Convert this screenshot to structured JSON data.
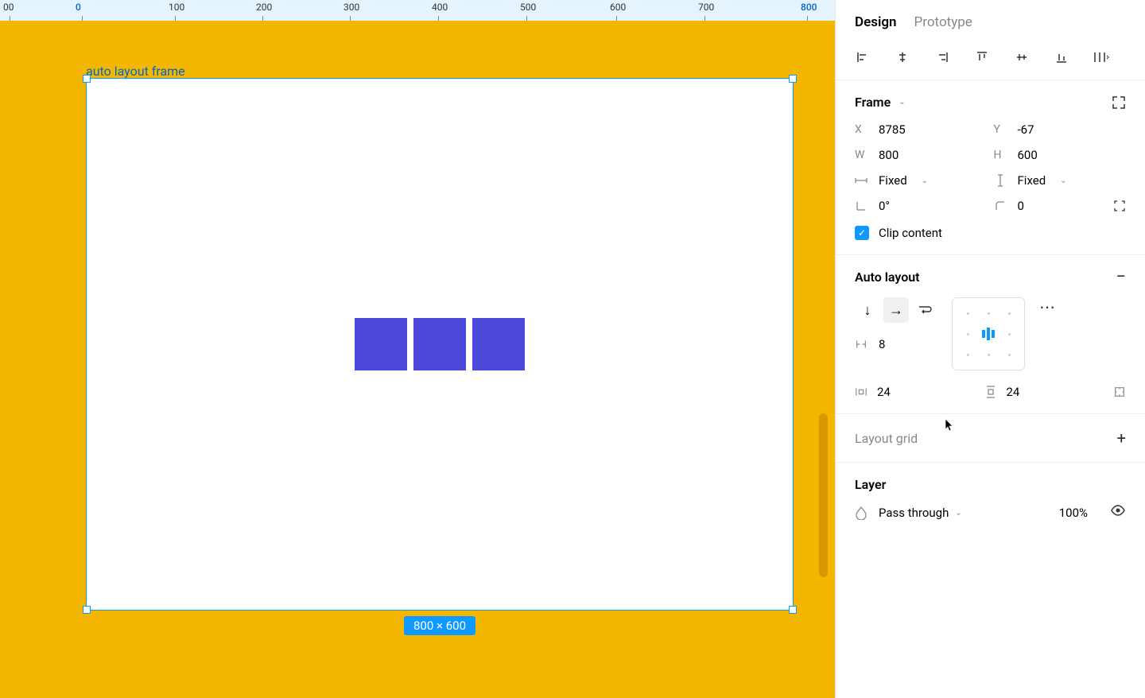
{
  "tabs": {
    "design": "Design",
    "prototype": "Prototype"
  },
  "ruler": {
    "marks": [
      {
        "label": "00",
        "pos": 4,
        "highlight": false
      },
      {
        "label": "0",
        "pos": 95,
        "highlight": true
      },
      {
        "label": "100",
        "pos": 212,
        "highlight": false
      },
      {
        "label": "200",
        "pos": 322,
        "highlight": false
      },
      {
        "label": "300",
        "pos": 432,
        "highlight": false
      },
      {
        "label": "400",
        "pos": 543,
        "highlight": false
      },
      {
        "label": "500",
        "pos": 654,
        "highlight": false
      },
      {
        "label": "600",
        "pos": 767,
        "highlight": false
      },
      {
        "label": "700",
        "pos": 878,
        "highlight": false
      },
      {
        "label": "800",
        "pos": 1007,
        "highlight": true
      }
    ]
  },
  "canvas": {
    "frame_label": "auto layout frame",
    "dimensions_badge": "800 × 600",
    "shape_color": "#4d49d8"
  },
  "frame": {
    "title": "Frame",
    "x_label": "X",
    "x_value": "8785",
    "y_label": "Y",
    "y_value": "-67",
    "w_label": "W",
    "w_value": "800",
    "h_label": "H",
    "h_value": "600",
    "wmode": "Fixed",
    "hmode": "Fixed",
    "rotation": "0°",
    "radius": "0",
    "clip_label": "Clip content"
  },
  "autolayout": {
    "title": "Auto layout",
    "gap": "8",
    "pad_h": "24",
    "pad_v": "24"
  },
  "layout_grid": {
    "title": "Layout grid"
  },
  "layer": {
    "title": "Layer",
    "blend": "Pass through",
    "opacity": "100%"
  }
}
